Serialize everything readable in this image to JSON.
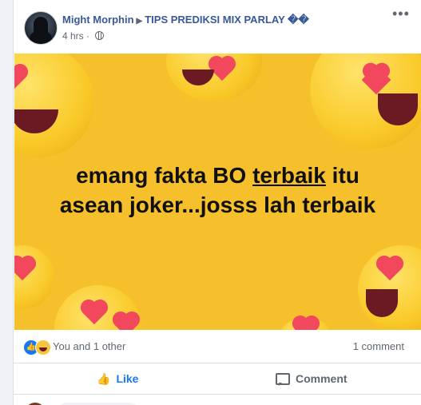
{
  "post": {
    "author": "Might Morphin",
    "group": "TIPS PREDIKSI MIX PARLAY ��",
    "timestamp": "4 hrs",
    "audience_icon": "globe-icon",
    "more_icon": "more-horizontal-icon"
  },
  "image": {
    "caption_line1_before": "emang fakta BO ",
    "caption_line1_underlined": "terbaik",
    "caption_line1_after": " itu",
    "caption_line2": "asean joker...josss lah terbaik",
    "background_color": "#f6c02c"
  },
  "stats": {
    "reaction_icons": [
      "like-reaction-icon",
      "haha-reaction-icon"
    ],
    "reactions_text": "You and 1 other",
    "comments_text": "1 comment"
  },
  "actions": {
    "like_label": "Like",
    "comment_label": "Comment"
  },
  "colors": {
    "link_blue": "#385898",
    "like_blue": "#1877f2",
    "muted_text": "#606770"
  }
}
